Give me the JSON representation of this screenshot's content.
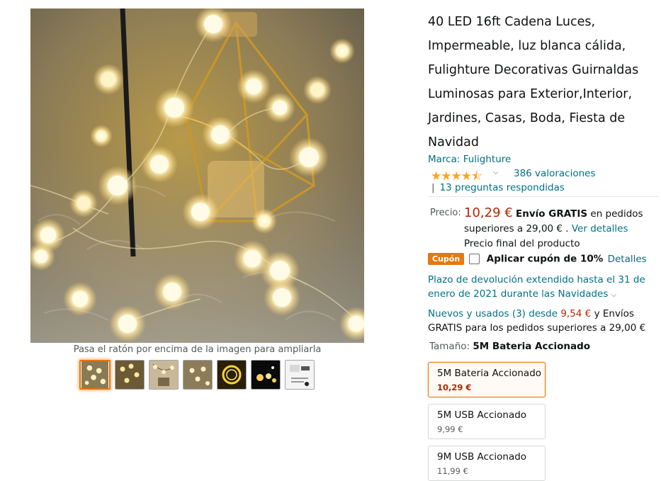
{
  "gallery": {
    "zoom_hint": "Pasa el ratón por encima de la imagen para ampliarla",
    "thumbnails": [
      {
        "name": "thumb-1",
        "selected": true
      },
      {
        "name": "thumb-2",
        "selected": false
      },
      {
        "name": "thumb-3",
        "selected": false
      },
      {
        "name": "thumb-4",
        "selected": false
      },
      {
        "name": "thumb-5",
        "selected": false
      },
      {
        "name": "thumb-6",
        "selected": false
      },
      {
        "name": "thumb-7",
        "selected": false
      }
    ]
  },
  "product": {
    "title": "40 LED 16ft Cadena Luces, Impermeable, luz blanca cálida, Fulighture Decorativas Guirnaldas Luminosas para Exterior,Interior, Jardines, Casas, Boda, Fiesta de Navidad",
    "brand": "Marca: Fulighture",
    "rating_stars": 4.5,
    "ratings_count": "386 valoraciones",
    "qa_separator": "|",
    "answered_questions": "13 preguntas respondidas"
  },
  "price": {
    "label": "Precio:",
    "value": "10,29 €",
    "free_shipping": "Envío GRATIS",
    "shipping_condition": " en pedidos superiores a 29,00 € . ",
    "details_link": "Ver detalles",
    "final_price_note": "Precio final del producto"
  },
  "coupon": {
    "badge": "Cupón",
    "text": "Aplicar cupón de 10%",
    "details_link": "Detalles"
  },
  "return_policy": "Plazo de devolución extendido hasta el 31 de enero de 2021 durante las Navidades",
  "offers": {
    "link": "Nuevos y usados (3) desde",
    "price": "9,54 €",
    "suffix": " y Envíos GRATIS para los pedidos superiores a 29,00 €"
  },
  "size": {
    "label": "Tamaño:",
    "value": "5M Bateria Accionado",
    "options": [
      {
        "name": "5M Bateria Accionado",
        "price": "10,29 €",
        "selected": true
      },
      {
        "name": "5M USB Accionado",
        "price": "9,99 €",
        "selected": false
      },
      {
        "name": "9M USB Accionado",
        "price": "11,99 €",
        "selected": false
      }
    ]
  },
  "colors": {
    "link": "#007185",
    "price": "#b12704",
    "star": "#ffa41c",
    "coupon_badge": "#e47911",
    "selected_border": "#e77600"
  }
}
